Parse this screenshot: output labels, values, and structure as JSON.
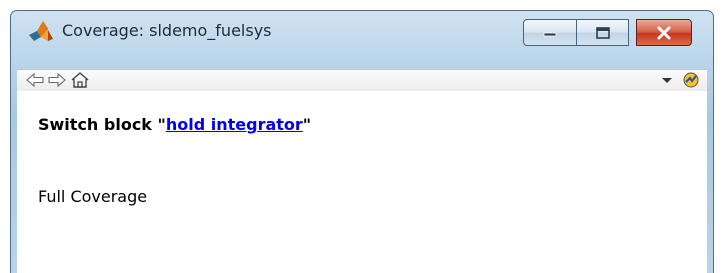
{
  "window": {
    "title": "Coverage: sldemo_fuelsys"
  },
  "title_controls": {
    "minimize": "minimize",
    "maximize": "maximize",
    "close": "close"
  },
  "toolbar": {
    "icons": [
      "back-arrow-icon",
      "forward-arrow-icon",
      "home-icon",
      "dropdown-arrow-icon",
      "matlab-help-icon"
    ]
  },
  "content": {
    "heading_prefix": "Switch block \"",
    "block_link": "hold integrator",
    "heading_suffix": "\"",
    "coverage_status": "Full Coverage"
  },
  "colors": {
    "link": "#0000ee",
    "close_button": "#c33b1f",
    "title_bar": "#bcd6eb"
  }
}
